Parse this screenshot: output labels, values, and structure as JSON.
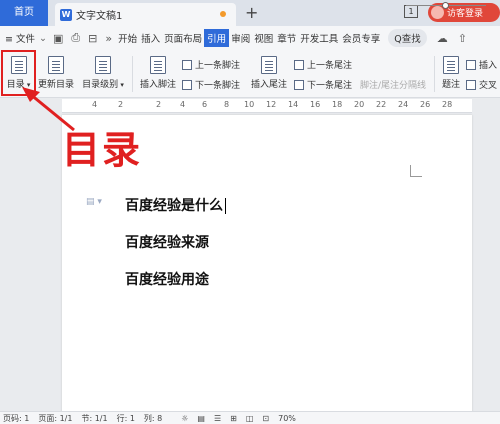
{
  "tabs": {
    "home": "首页",
    "doc_icon": "W",
    "doc_title": "文字文稿1",
    "new_tab": "+",
    "box_icon": "1",
    "login": "访客登录"
  },
  "menu": {
    "file": "≡ 文件",
    "items": [
      "开始",
      "插入",
      "页面布局",
      "引用",
      "审阅",
      "视图",
      "章节",
      "开发工具",
      "会员专享"
    ],
    "active_index": 3,
    "search": "Q查找"
  },
  "ribbon": {
    "toc": "目录",
    "update_toc": "更新目录",
    "toc_level": "目录级别",
    "insert_footnote": "插入脚注",
    "prev_footnote": "上一条脚注",
    "next_footnote": "下一条脚注",
    "insert_endnote": "插入尾注",
    "prev_endnote": "上一条尾注",
    "next_endnote": "下一条尾注",
    "footnote_sep": "脚注/尾注分隔线",
    "caption": "题注",
    "insert": "插入",
    "cross_ref": "交叉"
  },
  "ruler": [
    "4",
    "2",
    "2",
    "4",
    "6",
    "8",
    "10",
    "12",
    "14",
    "16",
    "18",
    "20",
    "22",
    "24",
    "26",
    "28"
  ],
  "document": {
    "lines": [
      "百度经验是什么",
      "百度经验来源",
      "百度经验用途"
    ]
  },
  "annotation": {
    "text": "目录",
    "color": "#e02020"
  },
  "status": {
    "page": "页码: 1",
    "pages": "页面: 1/1",
    "section": "节: 1/1",
    "row": "行: 1",
    "col": "列: 8",
    "zoom": "70%"
  },
  "colors": {
    "accent": "#2f6bd9",
    "login_bg": "#e0473a"
  }
}
